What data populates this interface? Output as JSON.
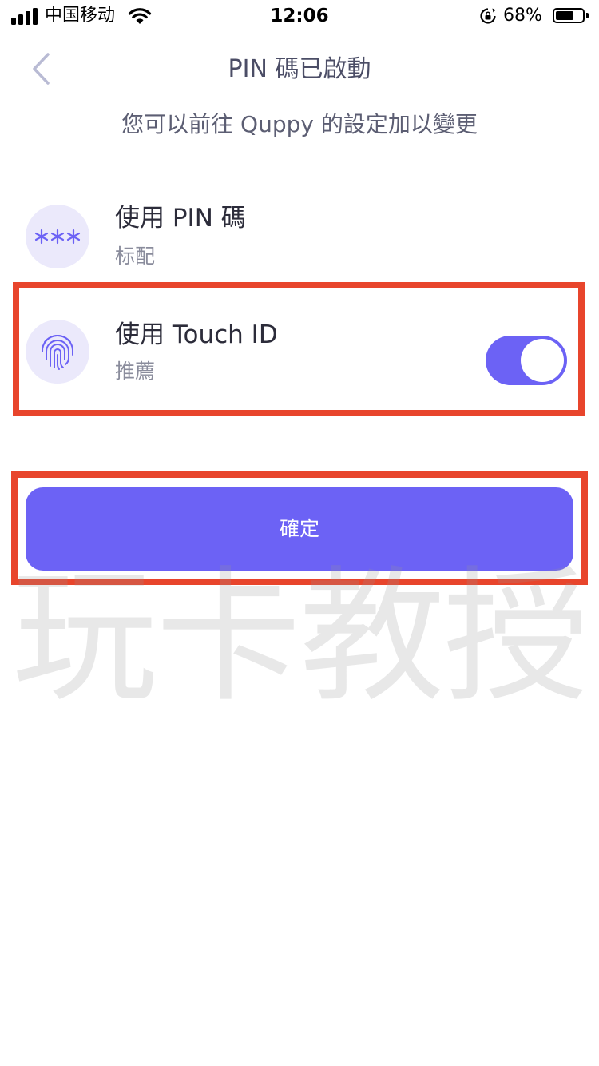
{
  "status_bar": {
    "carrier": "中国移动",
    "time": "12:06",
    "battery_percent": "68%",
    "battery_level": 0.68
  },
  "header": {
    "title": "PIN 碼已啟動",
    "subtitle": "您可以前往 Quppy 的設定加以變更",
    "back_icon": "chevron-left-icon"
  },
  "options": [
    {
      "title": "使用 PIN 碼",
      "subtitle": "标配",
      "icon": "asterisks-icon"
    },
    {
      "title": "使用 Touch ID",
      "subtitle": "推薦",
      "icon": "fingerprint-icon",
      "toggle_on": true
    }
  ],
  "confirm_button": {
    "label": "確定"
  },
  "watermark": "玩卡教授",
  "colors": {
    "accent": "#6c62f5",
    "icon_bg": "#ebe9fb",
    "highlight": "#e8452c"
  }
}
